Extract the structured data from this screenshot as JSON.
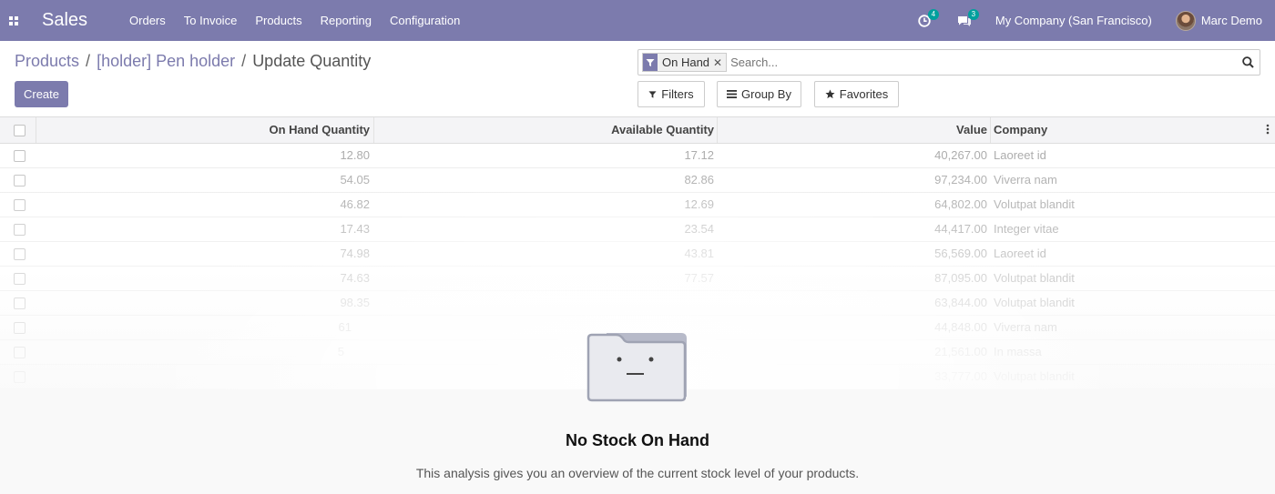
{
  "navbar": {
    "brand": "Sales",
    "menu": [
      "Orders",
      "To Invoice",
      "Products",
      "Reporting",
      "Configuration"
    ],
    "activity_count": "4",
    "message_count": "3",
    "company": "My Company (San Francisco)",
    "user": "Marc Demo",
    "color": "#7c7bad"
  },
  "breadcrumb": {
    "items": [
      "Products",
      "[holder] Pen holder"
    ],
    "separator": "/",
    "current": "Update Quantity"
  },
  "actions": {
    "create_label": "Create"
  },
  "search": {
    "facet_label": "On Hand",
    "placeholder": "Search...",
    "filters_label": "Filters",
    "group_by_label": "Group By",
    "favorites_label": "Favorites"
  },
  "table": {
    "columns": {
      "on_hand": "On Hand Quantity",
      "available": "Available Quantity",
      "value": "Value",
      "company": "Company"
    },
    "rows": [
      {
        "on_hand": "12.80",
        "available": "17.12",
        "value": "40,267.00",
        "company": "Laoreet id"
      },
      {
        "on_hand": "54.05",
        "available": "82.86",
        "value": "97,234.00",
        "company": "Viverra nam"
      },
      {
        "on_hand": "46.82",
        "available": "12.69",
        "value": "64,802.00",
        "company": "Volutpat blandit"
      },
      {
        "on_hand": "17.43",
        "available": "23.54",
        "value": "44,417.00",
        "company": "Integer vitae"
      },
      {
        "on_hand": "74.98",
        "available": "43.81",
        "value": "56,569.00",
        "company": "Laoreet id"
      },
      {
        "on_hand": "74.63",
        "available": "77.57",
        "value": "87,095.00",
        "company": "Volutpat blandit"
      },
      {
        "on_hand": "98.35",
        "available": "",
        "value": "63,844.00",
        "company": "Volutpat blandit"
      },
      {
        "on_hand": "61",
        "available": "",
        "value": "44,848.00",
        "company": "Viverra nam"
      },
      {
        "on_hand": "5",
        "available": "",
        "value": "21,561.00",
        "company": "In massa"
      },
      {
        "on_hand": "",
        "available": "",
        "value": "33,777.00",
        "company": "Volutpat blandit"
      }
    ]
  },
  "empty_state": {
    "title": "No Stock On Hand",
    "text": "This analysis gives you an overview of the current stock level of your products."
  }
}
